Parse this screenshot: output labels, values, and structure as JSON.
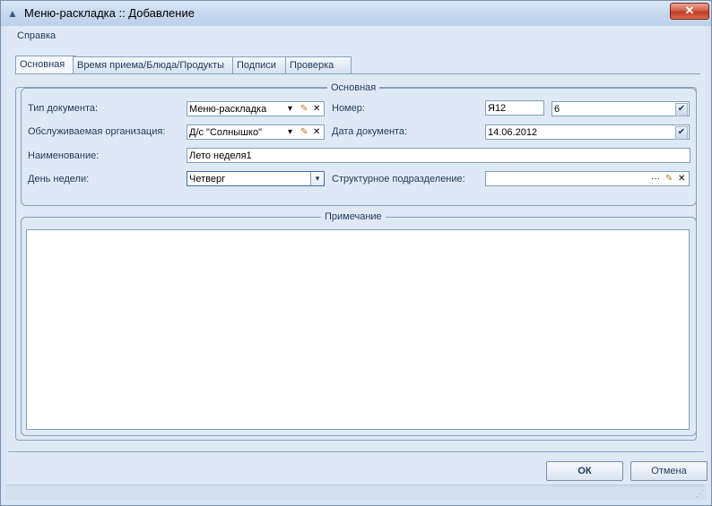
{
  "window": {
    "title": "Меню-раскладка :: Добавление",
    "close_label": "✕"
  },
  "menu": {
    "help": "Справка"
  },
  "tabs": [
    {
      "label": "Основная"
    },
    {
      "label": "Время приема/Блюда/Продукты"
    },
    {
      "label": "Подписи"
    },
    {
      "label": "Проверка"
    }
  ],
  "main_group": {
    "title": "Основная"
  },
  "fields": {
    "doc_type": {
      "label": "Тип документа:",
      "value": "Меню-раскладка"
    },
    "org": {
      "label": "Обслуживаемая организация:",
      "value": "Д/с \"Солнышко\""
    },
    "name": {
      "label": "Наименование:",
      "value": "Лето неделя1"
    },
    "weekday": {
      "label": "День недели:",
      "value": "Четверг"
    },
    "number": {
      "label": "Номер:",
      "prefix": "Я12",
      "value": "6"
    },
    "doc_date": {
      "label": "Дата документа:",
      "value": "14.06.2012"
    },
    "subdivision": {
      "label": "Структурное подразделение:",
      "value": ""
    }
  },
  "note_group": {
    "title": "Примечание",
    "value": ""
  },
  "buttons": {
    "ok": "ОК",
    "cancel": "Отмена"
  },
  "icons": {
    "dropdown": "▾",
    "pin": "✎",
    "clear": "✕",
    "ellipsis": "···",
    "check": "✔"
  }
}
